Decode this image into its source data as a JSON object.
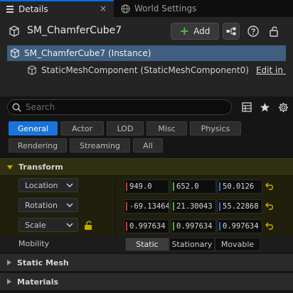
{
  "tabs": [
    {
      "label": "Details"
    },
    {
      "label": "World Settings"
    }
  ],
  "tab_close_glyph": "×",
  "header": {
    "actor_name": "SM_ChamferCube7",
    "add_label": "Add"
  },
  "tree": {
    "instance_label": "SM_ChamferCube7 (Instance)",
    "component_label": "StaticMeshComponent (StaticMeshComponent0)",
    "edit_link": "Edit in C+"
  },
  "search": {
    "placeholder": "Search"
  },
  "filters": [
    {
      "label": "General",
      "active": true
    },
    {
      "label": "Actor"
    },
    {
      "label": "LOD"
    },
    {
      "label": "Misc"
    },
    {
      "label": "Physics"
    },
    {
      "label": "Rendering"
    },
    {
      "label": "Streaming"
    },
    {
      "label": "All"
    }
  ],
  "sections": {
    "transform": "Transform",
    "static_mesh": "Static Mesh",
    "materials": "Materials"
  },
  "transform": {
    "location": {
      "label": "Location",
      "x": "949.0",
      "y": "652.0",
      "z": "50.0126"
    },
    "rotation": {
      "label": "Rotation",
      "x": "-69.13464",
      "y": "21.30043",
      "z": "55.22868"
    },
    "scale": {
      "label": "Scale",
      "x": "0.997634",
      "y": "0.997634",
      "z": "0.997634"
    }
  },
  "mobility": {
    "label": "Mobility",
    "options": [
      "Static",
      "Stationary",
      "Movable"
    ],
    "selected": "Static"
  },
  "colors": {
    "accent_blue": "#1a74d8",
    "selection_blue": "#3f5e80",
    "transform_highlight": "#c9a800",
    "axis_x": "#c23a3a",
    "axis_y": "#5aa83a",
    "axis_z": "#3a6ec8",
    "add_green": "#4ec24e"
  }
}
